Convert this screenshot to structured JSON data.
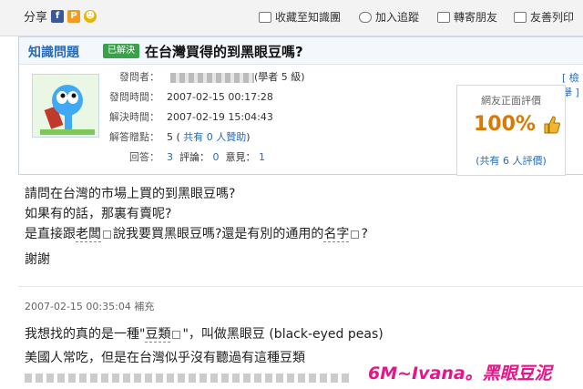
{
  "toolbar": {
    "share_label": "分享",
    "favorite_label": "收藏至知識團",
    "follow_label": "加入追蹤",
    "forward_label": "轉寄朋友",
    "print_label": "友善列印"
  },
  "question": {
    "category": "知識問題",
    "status": "已解決",
    "title": "在台灣買得的到黑眼豆嗎?",
    "asker_label": "發問者：",
    "asker_suffix": "(學者 5 級)",
    "asked_time_label": "發問時間：",
    "asked_time": "2007-02-15 00:17:28",
    "solved_time_label": "解決時間：",
    "solved_time": "2007-02-19 15:04:43",
    "points_label": "解答贈點：",
    "points": "5 (",
    "sponsor": "共有 0 人贊助",
    "points_close": ")",
    "answers_label": "回答：",
    "answers": "3",
    "comments_label": "評論：",
    "comments": "0",
    "opinions_label": "意見：",
    "opinions": "1",
    "report": "[ 檢舉 ]"
  },
  "rating": {
    "label": "網友正面評價",
    "percent": "100%",
    "count": "(共有 6 人評價)"
  },
  "body": {
    "line1": "請問在台灣的市場上買的到黑眼豆嗎?",
    "line2": "如果有的話，那裏有賣呢?",
    "line3_a": "是直接跟",
    "line3_kw1": "老闆",
    "line3_b": "說我要買黑眼豆嗎?還是有別的通用的",
    "line3_kw2": "名字",
    "line3_c": "?",
    "line4": "謝謝"
  },
  "supplement": {
    "label": "2007-02-15 00:35:04 補充",
    "line1_a": "我想找的真的是一種\"",
    "line1_kw": "豆類",
    "line1_b": "\"，叫做黑眼豆 (black-eyed peas)",
    "line2": "美國人常吃，但是在台灣似乎沒有聽過有這種豆類"
  },
  "watermark": "6M~Ivana。黑眼豆泥"
}
